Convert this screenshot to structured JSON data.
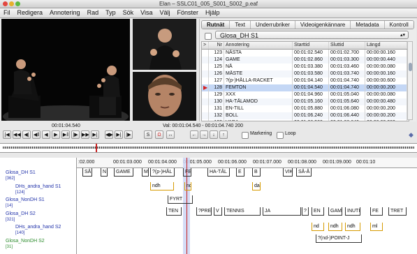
{
  "window": {
    "title": "Elan – SSLC01_005_S001_S002_p.eaf"
  },
  "menu": [
    "Fil",
    "Redigera",
    "Annotering",
    "Rad",
    "Typ",
    "Sök",
    "Visa",
    "Välj",
    "Fönster",
    "Hjälp"
  ],
  "panel": {
    "tabs": [
      "Rutnät",
      "Text",
      "Underrubriker",
      "Videoigenkännare",
      "Metadata",
      "Kontroll"
    ],
    "active_tab": "Rutnät",
    "tier_selected": "Glosa_DH S1",
    "columns": [
      "Nr",
      "Annotering",
      "Starttid",
      "Sluttid",
      "Längd"
    ],
    "rows": [
      [
        "123",
        "NÄSTA",
        "00:01:02.540",
        "00:01:02.700",
        "00:00:00.160"
      ],
      [
        "124",
        "GAME",
        "00:01:02.860",
        "00:01:03.300",
        "00:00:00.440"
      ],
      [
        "125",
        "NÅ",
        "00:01:03.380",
        "00:01:03.460",
        "00:00:00.080"
      ],
      [
        "126",
        "MÅSTE",
        "00:01:03.580",
        "00:01:03.740",
        "00:00:00.160"
      ],
      [
        "127",
        "?(p-)HÅLLA-RACKET",
        "00:01:04.140",
        "00:01:04.740",
        "00:00:00.600"
      ],
      [
        "128",
        "FEMTON",
        "00:01:04.540",
        "00:01:04.740",
        "00:00:00.200"
      ],
      [
        "129",
        "XXX",
        "00:01:04.960",
        "00:01:05.040",
        "00:00:00.080"
      ],
      [
        "130",
        "HA-TÅLAMOD",
        "00:01:05.160",
        "00:01:05.640",
        "00:00:00.480"
      ],
      [
        "131",
        "EN-TILL",
        "00:01:05.880",
        "00:01:06.080",
        "00:00:00.200"
      ],
      [
        "132",
        "BOLL",
        "00:01:06.240",
        "00:01:06.440",
        "00:00:00.200"
      ],
      [
        "133",
        "VARA",
        "00:01:06.560",
        "00:01:06.640",
        "00:00:00.080"
      ]
    ],
    "selected_row": 5
  },
  "readouts": {
    "current_time": "00:01:04.540",
    "selection": "Val: 00:01:04.540 - 00:01:04.740  200"
  },
  "controls": {
    "buttons": [
      "|◀",
      "◀◀",
      "◀|",
      "◀‖",
      "◀",
      "▶",
      "▶‖",
      "|▶",
      "▶▶",
      "▶|",
      "◀▶",
      "▶|",
      "|▶",
      "S",
      "Ω",
      "↔",
      "←",
      "→",
      "↓",
      "↑"
    ],
    "markering_label": "Markering",
    "loop_label": "Loop"
  },
  "ruler": {
    "ticks": [
      ":02.000",
      "00:01:03.000",
      "00:01:04.000",
      "00:01:05.000",
      "00:01:06.000",
      "00:01:07.000",
      "00:01:08.000",
      "00:01:09.000",
      "00:01:10"
    ]
  },
  "tiers": [
    {
      "name": "Glosa_DH S1",
      "count": "[362]",
      "child": false,
      "green": false
    },
    {
      "name": "DHs_andra_hand S1",
      "count": "[124]",
      "child": true,
      "green": false
    },
    {
      "name": "Glosa_NonDH S1",
      "count": "[14]",
      "child": false,
      "green": false
    },
    {
      "name": "Glosa_DH S2",
      "count": "[321]",
      "child": false,
      "green": false
    },
    {
      "name": "DHs_andra_hand S2",
      "count": "[140]",
      "child": true,
      "green": false
    },
    {
      "name": "Glosa_NonDH S2",
      "count": "[31]",
      "child": false,
      "green": true
    }
  ],
  "annotations": {
    "row1": [
      "SÅ",
      "N",
      "GAME",
      "M",
      "?(p-)HÅL",
      "FE",
      "HA-TÅL",
      "E",
      "B",
      "VIK",
      "SÅ-Å"
    ],
    "row2": [
      "ndh",
      "nd",
      "da"
    ],
    "row3": [
      "FYRT"
    ],
    "row4": [
      "TEN",
      "?PRE",
      "V",
      "TENNIS",
      "JA",
      "?",
      "EN",
      "GAM",
      "INUTI",
      "FE",
      "TRET"
    ],
    "row5": [
      "nd",
      "ndh",
      "ndh",
      "ml"
    ],
    "row6": [
      "?(nd-)POINT-J"
    ]
  }
}
